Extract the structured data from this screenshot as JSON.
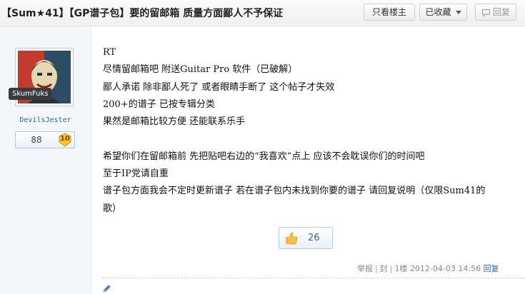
{
  "thread": {
    "title": "【Sum★41】【GP谱子包】要的留邮箱 质量方面鄙人不予保证"
  },
  "toolbar": {
    "only_author_label": "只看楼主",
    "favorited_label": "已收藏",
    "reply_label": "回复",
    "favorited_icon": "caret-down-icon",
    "reply_icon": "comment-icon"
  },
  "author": {
    "name_tag": "SkumFuks",
    "username": "DevilsJester",
    "posts_count": "88",
    "level": "10",
    "accent_color": "#2d64b3"
  },
  "post": {
    "lines": [
      "RT",
      "尽情留邮箱吧 附送Guitar Pro 软件（已破解）",
      "鄙人承诺 除非鄙人死了 或者眼睛手断了 这个帖子才失效",
      "200+的谱子 已按专辑分类",
      "果然是邮箱比较方便 还能联系乐手",
      "",
      "希望你们在留邮箱前 先把贴吧右边的“我喜欢”点上 应该不会耽误你们的时间吧",
      "至于IP党请自重",
      "谱子包方面我会不定时更新谱子 若在谱子包内未找到你要的谱子 请回复说明（仅限Sum41的",
      "歌）"
    ]
  },
  "like": {
    "count": "26",
    "icon": "thumbs-up-icon"
  },
  "footer": {
    "report": "举报",
    "separator": "|",
    "block": "封",
    "floor": "1楼",
    "timestamp": "2012-04-03 14:56",
    "reply": "回复"
  }
}
